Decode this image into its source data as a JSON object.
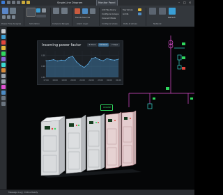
{
  "titlebar": {
    "tabs": [
      {
        "label": "Single-Line Diagram",
        "active": false
      },
      {
        "label": "Monitor Panel",
        "active": true
      }
    ],
    "window_controls": [
      "–",
      "□",
      "×"
    ]
  },
  "ribbon": {
    "groups": [
      {
        "label": "Power Flow Analysis"
      },
      {
        "label": "Simulation"
      },
      {
        "label": "Compare Ranges"
      },
      {
        "label": "Alarm Logic"
      },
      {
        "label": "Configure Views"
      },
      {
        "label": "Data & Values"
      },
      {
        "label": "Network"
      }
    ],
    "commands": [
      {
        "label": "Trends Sources"
      },
      {
        "label": "Add Tag Query"
      },
      {
        "label": "Configure Groups"
      },
      {
        "label": "Connect Mode"
      },
      {
        "label": "Tag Values"
      },
      {
        "label": "Limits"
      },
      {
        "label": "Refresh"
      }
    ]
  },
  "chart_panel": {
    "title": "Incoming power factor",
    "range_buttons": [
      {
        "label": "8 Hours",
        "active": false
      },
      {
        "label": "24 Hours",
        "active": true
      },
      {
        "label": "7 Days",
        "active": false
      }
    ]
  },
  "chart_data": {
    "type": "area",
    "title": "Incoming power factor",
    "x": [
      "17:00",
      "18:00",
      "19:00",
      "20:00",
      "21:00",
      "22:00",
      "23:00",
      "00:00",
      "01:00"
    ],
    "y_ticks": [
      "0.95",
      "0.90",
      "0.85"
    ],
    "series": [
      {
        "values": [
          0.925,
          0.927,
          0.93,
          0.924,
          0.928,
          0.926,
          0.94,
          0.945,
          0.92,
          0.905,
          0.895,
          0.91,
          0.935,
          0.94,
          0.93,
          0.925,
          0.935,
          0.93,
          0.928,
          0.932
        ]
      }
    ],
    "ylim": [
      0.85,
      0.97
    ],
    "grid": true,
    "color": "#4ea3e0"
  },
  "badge": {
    "label": "ONLINE"
  },
  "status_bar": {
    "text": "Message Log  |  Online  Ready"
  },
  "colors": {
    "accent": "#4ea3e0",
    "status_green": "#2fd85e",
    "diagram_cyan": "#3ad9d0",
    "diagram_magenta": "#e04fd2",
    "alarm_red": "#e0453c"
  },
  "icons": [
    "app-logo-icon",
    "new-file-icon",
    "open-icon",
    "save-icon",
    "undo-icon",
    "redo-icon",
    "select-icon",
    "pen-icon",
    "wire-icon",
    "text-icon",
    "zoom-icon",
    "hand-icon"
  ]
}
